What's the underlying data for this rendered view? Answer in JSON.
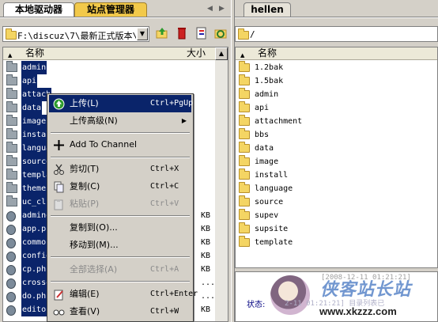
{
  "left_tabs": {
    "local": "本地驱动器",
    "site_manager": "站点管理器"
  },
  "right_tabs": {
    "server": "hellen"
  },
  "left_path": "F:\\discuz\\7\\最新正式版本\\",
  "right_path": "/",
  "left_columns": {
    "name": "名称",
    "size": "大小"
  },
  "right_columns": {
    "name": "名称"
  },
  "left_files": [
    {
      "name": "admin",
      "type": "folder",
      "selected": true
    },
    {
      "name": "api",
      "type": "folder",
      "selected": true
    },
    {
      "name": "attach",
      "type": "folder",
      "selected": true
    },
    {
      "name": "data",
      "type": "folder",
      "selected": true
    },
    {
      "name": "image",
      "type": "folder",
      "selected": true
    },
    {
      "name": "instal",
      "type": "folder",
      "selected": true
    },
    {
      "name": "langua",
      "type": "folder",
      "selected": true
    },
    {
      "name": "source",
      "type": "folder",
      "selected": true
    },
    {
      "name": "templa",
      "type": "folder",
      "selected": true
    },
    {
      "name": "theme",
      "type": "folder",
      "selected": true
    },
    {
      "name": "uc_cli",
      "type": "folder",
      "selected": true
    },
    {
      "name": "admino",
      "type": "file",
      "selected": true,
      "size": "KB"
    },
    {
      "name": "app.ph",
      "type": "file",
      "selected": true,
      "size": "KB"
    },
    {
      "name": "common",
      "type": "file",
      "selected": true,
      "size": "KB"
    },
    {
      "name": "config",
      "type": "file",
      "selected": true,
      "size": "KB"
    },
    {
      "name": "cp.php",
      "type": "file",
      "selected": true,
      "size": "KB"
    },
    {
      "name": "crosso",
      "type": "file",
      "selected": true,
      "size": "..."
    },
    {
      "name": "do.php",
      "type": "file",
      "selected": true,
      "size": "..."
    },
    {
      "name": "editor",
      "type": "file",
      "selected": true,
      "size": "KB"
    }
  ],
  "right_files": [
    "1.2bak",
    "1.5bak",
    "admin",
    "api",
    "attachment",
    "bbs",
    "data",
    "image",
    "install",
    "language",
    "source",
    "supev",
    "supsite",
    "template"
  ],
  "context_menu": {
    "upload": {
      "label": "上传(L)",
      "shortcut": "Ctrl+PgUp"
    },
    "upload_adv": {
      "label": "上传高级(N)"
    },
    "add_channel": {
      "label": "Add To Channel"
    },
    "cut": {
      "label": "剪切(T)",
      "shortcut": "Ctrl+X"
    },
    "copy": {
      "label": "复制(C)",
      "shortcut": "Ctrl+C"
    },
    "paste": {
      "label": "粘贴(P)",
      "shortcut": "Ctrl+V"
    },
    "copy_to": {
      "label": "复制到(O)..."
    },
    "move_to": {
      "label": "移动到(M)..."
    },
    "select_all": {
      "label": "全部选择(A)",
      "shortcut": "Ctrl+A"
    },
    "edit": {
      "label": "编辑(E)",
      "shortcut": "Ctrl+Enter"
    },
    "view": {
      "label": "查看(V)",
      "shortcut": "Ctrl+W"
    }
  },
  "status": {
    "label": "状态:",
    "log1": "[2008-12-11 01:21:21]",
    "log2": "2-11 01:21:21] 目录列表已",
    "watermark_cn": "侠客站长站",
    "watermark_url": "www.xkzzz.com"
  },
  "colors": {
    "selection": "#0a246a",
    "menu_bg": "#d4d0c8",
    "tab_inactive": "#f2c94a"
  }
}
